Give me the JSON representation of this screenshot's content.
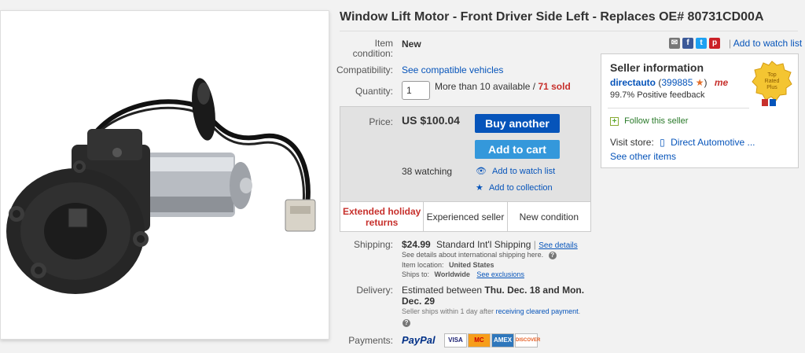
{
  "listing": {
    "title": "Window Lift Motor - Front Driver Side Left - Replaces OE# 80731CD00A",
    "image_alt": "window-lift-motor-photo"
  },
  "details": {
    "condition_label_1": "Item",
    "condition_label_2": "condition:",
    "condition_value": "New",
    "compat_label": "Compatibility:",
    "compat_link": "See compatible vehicles",
    "qty_label": "Quantity:",
    "qty_value": "1",
    "availability": "More than 10 available /",
    "sold": "71 sold"
  },
  "share": {
    "watch_link": "Add to watch list",
    "separator": "|"
  },
  "buy": {
    "price_label": "Price:",
    "price": "US $100.04",
    "buy_button": "Buy another",
    "cart_button": "Add to cart",
    "watching": "38 watching",
    "watch_link": "Add to watch list",
    "collection_link": "Add to collection",
    "features": [
      "Extended holiday returns",
      "Experienced seller",
      "New condition"
    ]
  },
  "seller": {
    "heading": "Seller information",
    "name": "directauto",
    "score_open": "(",
    "score": "399885",
    "score_close": ")",
    "me_badge": "me",
    "feedback": "99.7% Positive feedback",
    "follow": "Follow this seller",
    "store_label": "Visit store:",
    "store_name": "Direct Automotive ...",
    "other_items": "See other items",
    "badge_text_1": "Top",
    "badge_text_2": "Rated",
    "badge_text_3": "Plus"
  },
  "shipping": {
    "label": "Shipping:",
    "cost": "$24.99",
    "method": "Standard Int'l Shipping",
    "sep": "|",
    "see_details": "See details",
    "intl_note": "See details about international shipping here.",
    "location_label": "Item location:",
    "location": "United States",
    "ships_to_label": "Ships to:",
    "ships_to": "Worldwide",
    "exclusions": "See exclusions"
  },
  "delivery": {
    "label": "Delivery:",
    "prefix": "Estimated between",
    "range_1": "Thu. Dec. 18 and Mon. Dec.",
    "range_2": "29",
    "note_1": "Seller ships within 1 day after",
    "note_link": "receiving cleared payment",
    "note_end": "."
  },
  "payments": {
    "label": "Payments:",
    "paypal": "PayPal",
    "cards": [
      "VISA",
      "MC",
      "AMEX",
      "DISCOVER"
    ]
  },
  "colors": {
    "link": "#0654ba",
    "sold_red": "#c7302c",
    "buy_button": "#0654ba",
    "cart_button": "#3498db",
    "panel_bg": "#e2e2e2"
  }
}
